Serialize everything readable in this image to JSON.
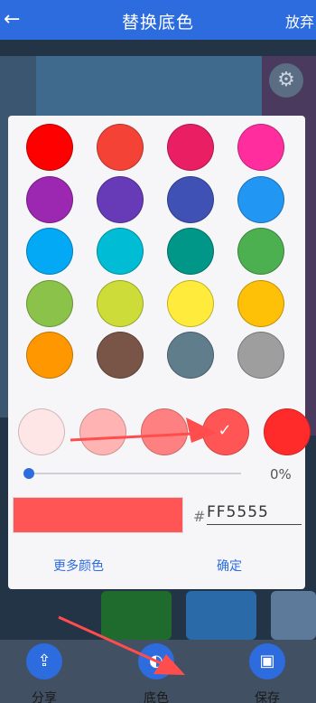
{
  "appbar": {
    "title": "替换底色",
    "action": "放弃",
    "back_glyph": "←"
  },
  "dialog": {
    "palette": [
      "#ff0000",
      "#f44336",
      "#e91e63",
      "#ff2d9e",
      "#9c27b0",
      "#673ab7",
      "#3f51b5",
      "#2196f3",
      "#03a9f4",
      "#00bcd4",
      "#009688",
      "#4caf50",
      "#8bc34a",
      "#cddc39",
      "#ffeb3b",
      "#ffc107",
      "#ff9800",
      "#795548",
      "#607d8b",
      "#9e9e9e"
    ],
    "shades": [
      "#ffe6e6",
      "#ffb3b3",
      "#ff8080",
      "#ff5555",
      "#ff2b2b"
    ],
    "selected_shade_index": 3,
    "selected_glyph": "✓",
    "opacity_value": "0%",
    "opacity_fraction": 0,
    "preview_color": "#ff5555",
    "hash_symbol": "#",
    "hex_value": "FF5555",
    "more_colors_label": "更多颜色",
    "confirm_label": "确定"
  },
  "toolbar": {
    "items": [
      {
        "label": "分享",
        "icon": "share-icon",
        "glyph": "⇪"
      },
      {
        "label": "底色",
        "icon": "palette-icon",
        "glyph": "◐"
      },
      {
        "label": "保存",
        "icon": "save-icon",
        "glyph": "▣"
      }
    ]
  },
  "colors": {
    "primary": "#2d6cdf",
    "annotation_arrow": "#ff4d4d"
  }
}
